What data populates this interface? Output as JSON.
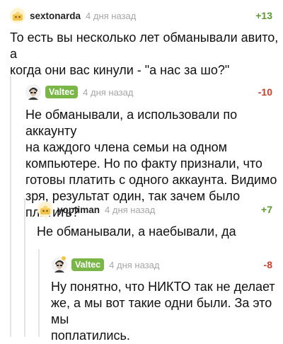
{
  "comments": [
    {
      "author": "sextonarda",
      "time": "4 дня назад",
      "rating": "+13",
      "text": "То есть вы несколько лет обманывали авито, а\nкогда они вас кинули - \"а нас за шо?\""
    },
    {
      "author": "Valtec",
      "time": "4 дня назад",
      "rating": "-10",
      "text": "Не обманывали, а использовали по аккаунту\nна каждого члена семьи на одном\nкомпьютере. Но по факту признали, что\nготовы платить с одного аккаунта. Видимо\nзря, результат один, так зачем было платить?"
    },
    {
      "author": "yoptiman",
      "time": "4 дня назад",
      "rating": "+7",
      "text": "Не обманывали, а наебывали, да"
    },
    {
      "author": "Valtec",
      "time": "4 дня назад",
      "rating": "-8",
      "text": "Ну понятно, что НИКТО так не делает\nже, а мы вот такие одни были. За это мы\nпоплатились."
    }
  ],
  "colors": {
    "positive": "#5b9a2c",
    "negative": "#c8402c",
    "badge": "#7ab648",
    "branch": "#e3e3e3"
  },
  "icons": {
    "avatar_default": "pikabu-default-avatar-icon",
    "avatar_valtec": "portrait-avatar-icon"
  }
}
